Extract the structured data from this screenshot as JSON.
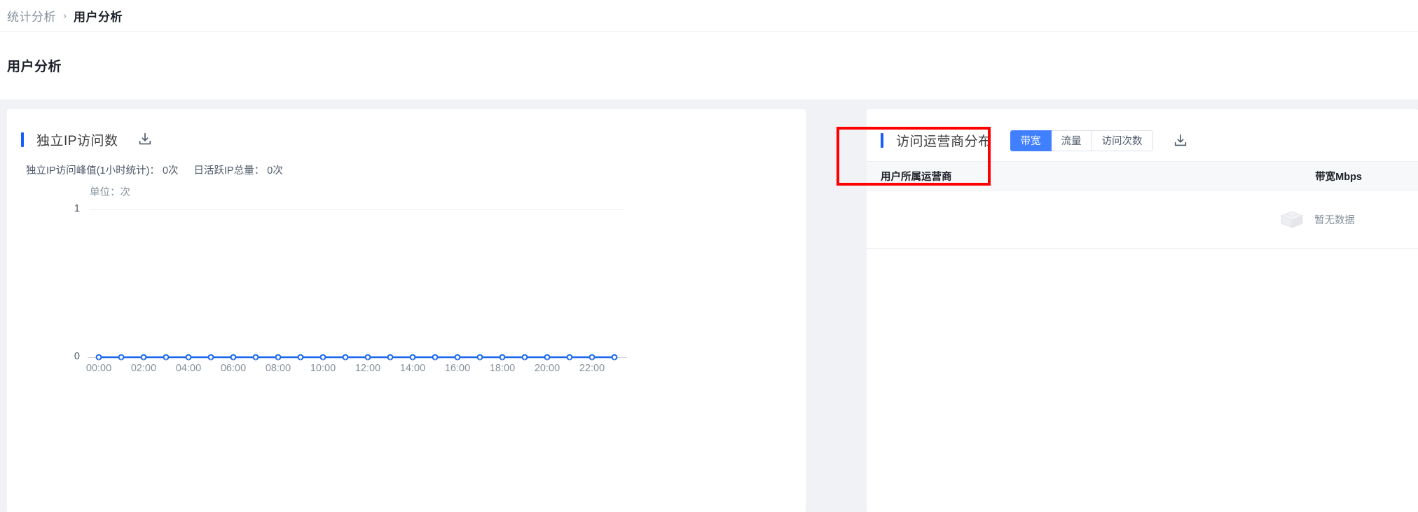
{
  "breadcrumb": {
    "parent": "统计分析",
    "separator": "›",
    "current": "用户分析"
  },
  "page": {
    "title": "用户分析"
  },
  "left_panel": {
    "title": "独立IP访问数",
    "download_icon": "download-icon",
    "stats": {
      "peak_label": "独立IP访问峰值(1小时统计)：",
      "peak_value": "0次",
      "total_label": "日活跃IP总量：",
      "total_value": "0次"
    },
    "unit": "单位：次"
  },
  "right_panel": {
    "title": "访问运营商分布",
    "download_icon": "download-icon",
    "tabs": [
      {
        "label": "带宽",
        "active": true
      },
      {
        "label": "流量",
        "active": false
      },
      {
        "label": "访问次数",
        "active": false
      }
    ],
    "table": {
      "columns": [
        "用户所属运营商",
        "带宽Mbps"
      ],
      "rows": [],
      "empty_text": "暂无数据",
      "empty_icon": "empty-box-icon"
    }
  },
  "colors": {
    "accent": "#165dff",
    "tab_active": "#4080ff",
    "line": "#1866f0",
    "annotation": "#ff0000",
    "page_bg": "#f0f2f5",
    "card_bg": "#ffffff"
  },
  "chart_data": {
    "type": "line",
    "title": "独立IP访问数",
    "xlabel": "",
    "ylabel": "单位：次",
    "ylim": [
      0,
      1
    ],
    "yticks": [
      "0",
      "1"
    ],
    "grid": true,
    "legend": false,
    "x": [
      "00:00",
      "01:00",
      "02:00",
      "03:00",
      "04:00",
      "05:00",
      "06:00",
      "07:00",
      "08:00",
      "09:00",
      "10:00",
      "11:00",
      "12:00",
      "13:00",
      "14:00",
      "15:00",
      "16:00",
      "17:00",
      "18:00",
      "19:00",
      "20:00",
      "21:00",
      "22:00",
      "23:00"
    ],
    "xticklabels": [
      "00:00",
      "02:00",
      "04:00",
      "06:00",
      "08:00",
      "10:00",
      "12:00",
      "14:00",
      "16:00",
      "18:00",
      "20:00",
      "22:00"
    ],
    "series": [
      {
        "name": "独立IP访问数",
        "color": "#1866f0",
        "values": [
          0,
          0,
          0,
          0,
          0,
          0,
          0,
          0,
          0,
          0,
          0,
          0,
          0,
          0,
          0,
          0,
          0,
          0,
          0,
          0,
          0,
          0,
          0,
          0
        ]
      }
    ]
  }
}
